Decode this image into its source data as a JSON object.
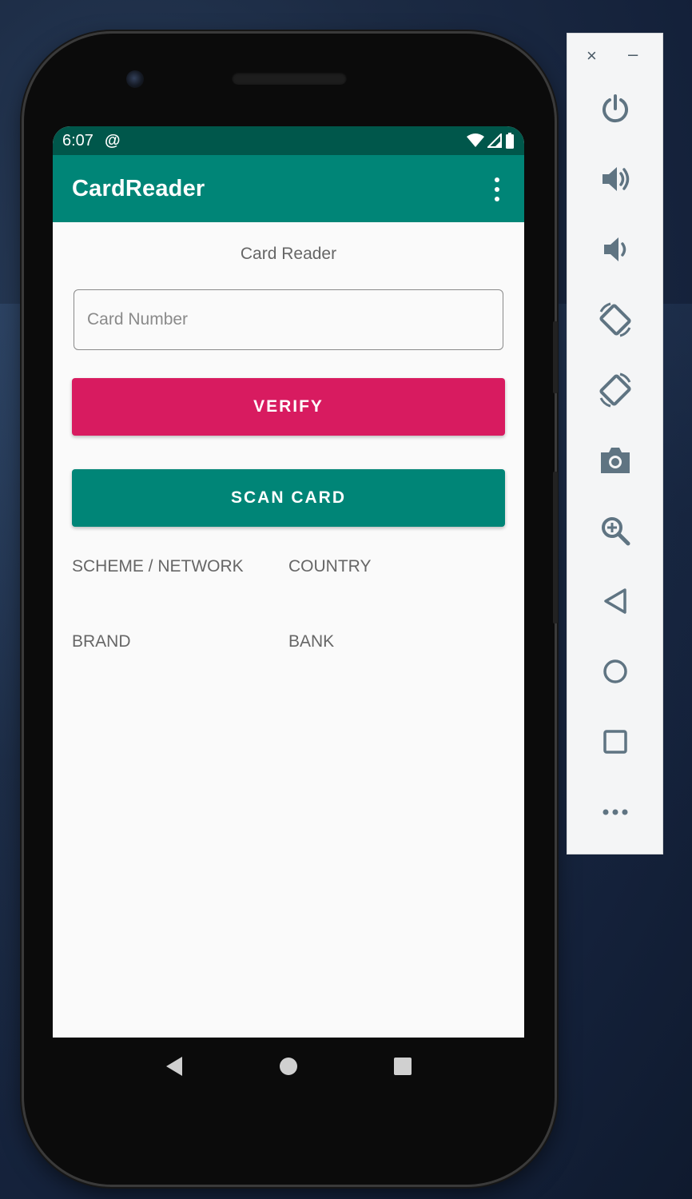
{
  "status_bar": {
    "time": "6:07",
    "at_icon": "@"
  },
  "app_bar": {
    "title": "CardReader",
    "menu_icon": "overflow-menu-icon"
  },
  "main": {
    "heading": "Card Reader",
    "card_input": {
      "value": "",
      "placeholder": "Card Number"
    },
    "verify_button": "VERIFY",
    "scan_button": "SCAN CARD",
    "fields": {
      "scheme": "SCHEME / NETWORK",
      "country": "COUNTRY",
      "brand": "BRAND",
      "bank": "BANK"
    }
  },
  "nav_bar": {
    "items": [
      "back-icon",
      "home-icon",
      "recents-icon"
    ]
  },
  "emulator_toolbar": {
    "close": "×",
    "minimize": "–",
    "tools": [
      "power-icon",
      "volume-up-icon",
      "volume-down-icon",
      "rotate-left-icon",
      "rotate-right-icon",
      "camera-icon",
      "zoom-icon",
      "back-icon",
      "home-icon",
      "overview-icon",
      "more-icon"
    ]
  },
  "colors": {
    "status_bar": "#00574b",
    "app_bar": "#008577",
    "verify": "#d81b60",
    "scan": "#008577"
  }
}
